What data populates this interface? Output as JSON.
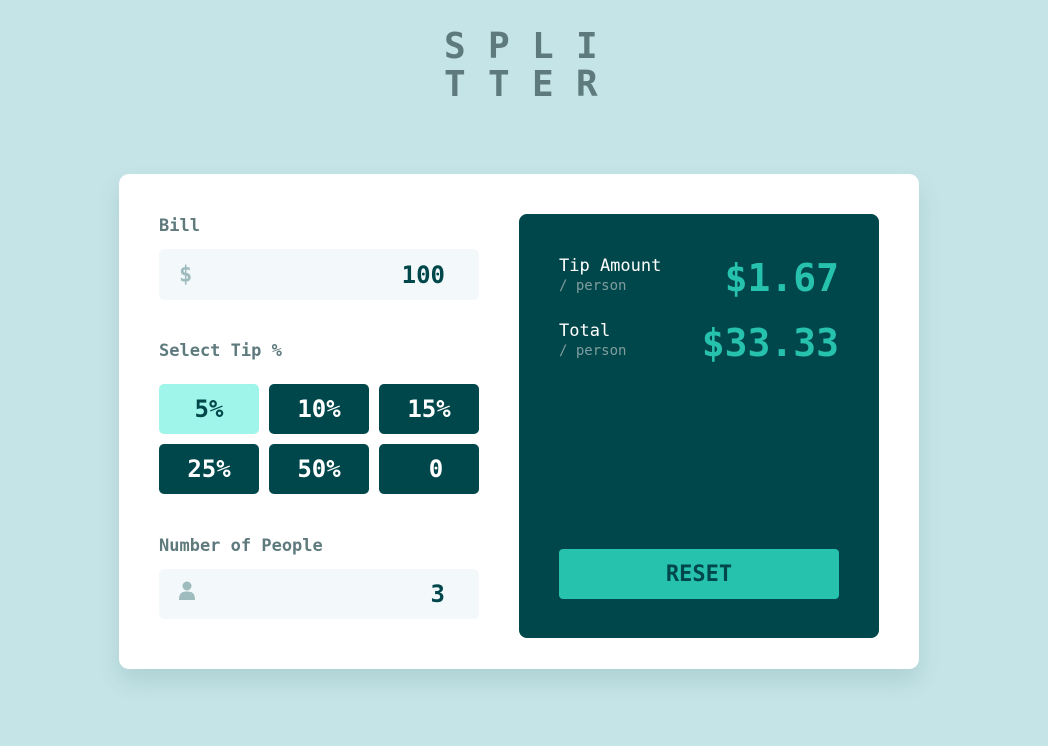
{
  "logo": {
    "line1": "SPLI",
    "line2": "TTER"
  },
  "bill": {
    "label": "Bill",
    "currency_icon": "$",
    "value": "100"
  },
  "tip": {
    "label": "Select Tip %",
    "options": [
      "5%",
      "10%",
      "15%",
      "25%",
      "50%"
    ],
    "custom_value": "0",
    "selected": "5%"
  },
  "people": {
    "label": "Number of People",
    "icon": "person-icon",
    "value": "3"
  },
  "results": {
    "tip_amount": {
      "label": "Tip Amount",
      "sub": "/ person",
      "value": "$1.67"
    },
    "total": {
      "label": "Total",
      "sub": "/ person",
      "value": "$33.33"
    }
  },
  "reset_label": "RESET",
  "colors": {
    "background": "#c5e4e7",
    "panel": "#00474b",
    "accent": "#26c2ad",
    "active_tip": "#9ff5e9"
  }
}
